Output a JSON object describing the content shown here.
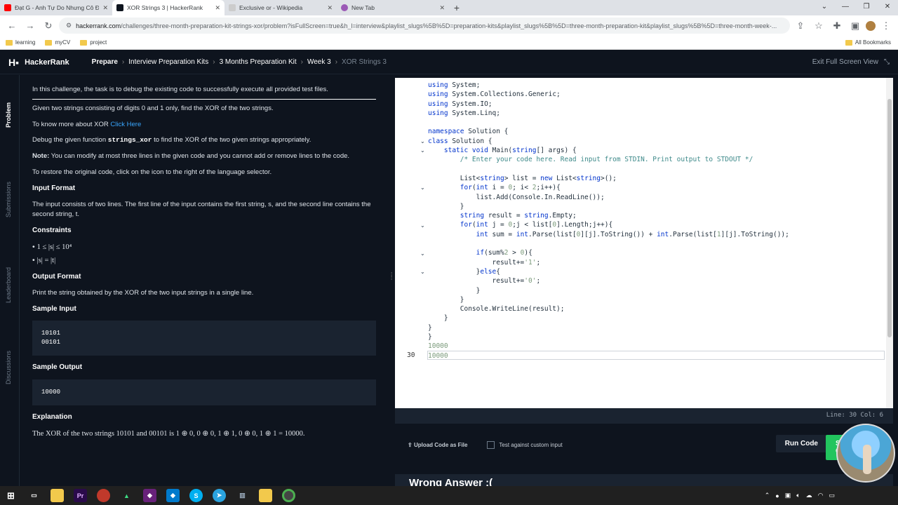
{
  "browser": {
    "tabs": [
      {
        "title": "Đạt G - Anh Tự Do Nhưng Cô Đơn",
        "color": "#ff0000",
        "active": false
      },
      {
        "title": "XOR Strings 3 | HackerRank",
        "color": "#0e141e",
        "active": true
      },
      {
        "title": "Exclusive or - Wikipedia",
        "color": "#888888",
        "active": false
      },
      {
        "title": "New Tab",
        "color": "#9b59b6",
        "active": false
      }
    ],
    "url_host": "hackerrank.com",
    "url_path": "/challenges/three-month-preparation-kit-strings-xor/problem?isFullScreen=true&h_l=interview&playlist_slugs%5B%5D=preparation-kits&playlist_slugs%5B%5D=three-month-preparation-kit&playlist_slugs%5B%5D=three-month-week-...",
    "bookmarks": [
      "learning",
      "myCV",
      "project"
    ],
    "all_bookmarks": "All Bookmarks"
  },
  "header": {
    "brand": "HackerRank",
    "crumbs": [
      "Prepare",
      "Interview Preparation Kits",
      "3 Months Preparation Kit",
      "Week 3"
    ],
    "current": "XOR Strings 3",
    "exit": "Exit Full Screen View"
  },
  "sidebar": {
    "tabs": [
      "Problem",
      "Submissions",
      "Leaderboard",
      "Discussions"
    ]
  },
  "problem": {
    "intro": "In this challenge, the task is to debug the existing code to successfully execute all provided test files.",
    "p1": "Given two strings consisting of digits 0 and 1 only, find the XOR of the two strings.",
    "p2_pre": "To know more about XOR ",
    "p2_link": "Click Here",
    "p3_pre": "Debug the given function ",
    "p3_code": "strings_xor",
    "p3_post": " to find the XOR of the two given strings appropriately.",
    "note_label": "Note:",
    "note_text": " You can modify at most three lines in the given code and you cannot add or remove lines to the code.",
    "p4": "To restore the original code, click on the icon to the right of the language selector.",
    "input_h": "Input Format",
    "input_text": "The input consists of two lines. The first line of the input contains the first string, s, and the second line contains the second string, t.",
    "constraints_h": "Constraints",
    "c1": "1 ≤ |s| ≤ 10⁴",
    "c2": "|s| = |t|",
    "output_h": "Output Format",
    "output_text": "Print the string obtained by the XOR of the two input strings in a single line.",
    "sample_in_h": "Sample Input",
    "sample_in": "10101\n00101",
    "sample_out_h": "Sample Output",
    "sample_out": "10000",
    "expl_h": "Explanation",
    "expl_text": "The XOR of the two strings 10101 and 00101 is 1 ⊕ 0,  0 ⊕ 0,  1 ⊕ 1,  0 ⊕ 0,  1 ⊕ 1 = 10000."
  },
  "editor": {
    "line_number": "30",
    "status": "Line: 30  Col: 6"
  },
  "actions": {
    "upload": "Upload Code as File",
    "custom": "Test against custom input",
    "run": "Run Code",
    "submit": "Submit Code",
    "result": "Wrong Answer :("
  }
}
